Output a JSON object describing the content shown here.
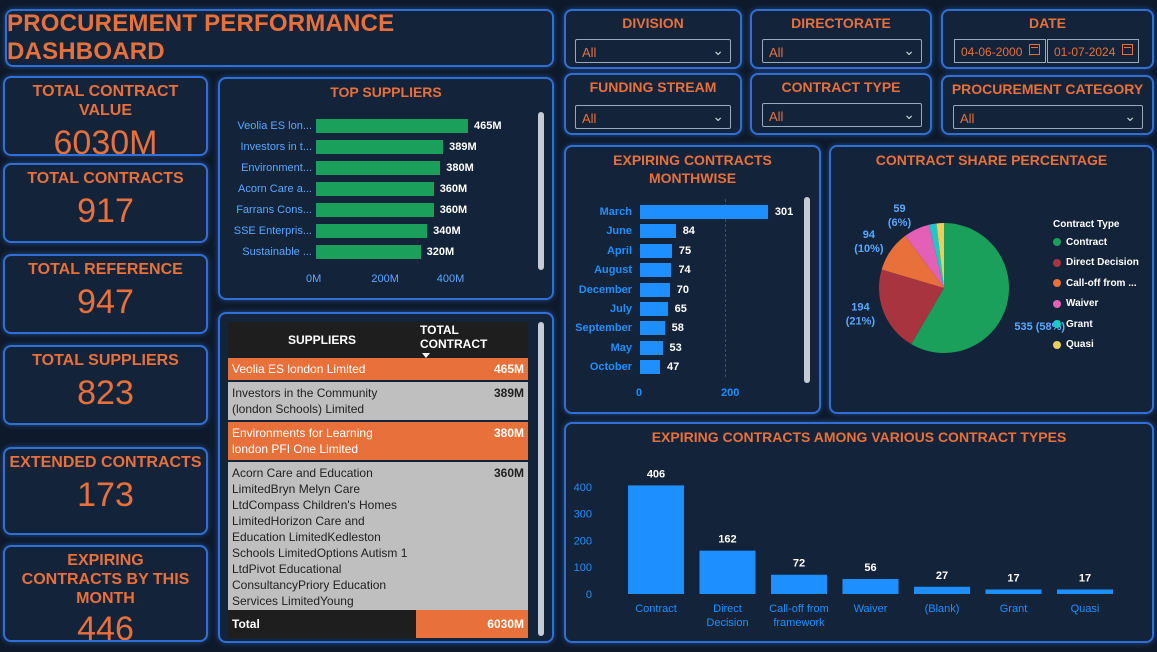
{
  "header": {
    "title": "PROCUREMENT PERFORMANCE DASHBOARD"
  },
  "kpis": [
    {
      "label": "TOTAL CONTRACT VALUE",
      "value": "6030M"
    },
    {
      "label": "TOTAL CONTRACTS",
      "value": "917"
    },
    {
      "label": "TOTAL REFERENCE",
      "value": "947"
    },
    {
      "label": "TOTAL SUPPLIERS",
      "value": "823"
    },
    {
      "label": "EXTENDED CONTRACTS",
      "value": "173"
    },
    {
      "label": "EXPIRING CONTRACTS BY THIS MONTH",
      "value": "446"
    }
  ],
  "slicers": {
    "division": {
      "title": "DIVISION",
      "value": "All"
    },
    "directorate": {
      "title": "DIRECTORATE",
      "value": "All"
    },
    "date": {
      "title": "DATE",
      "from": "04-06-2000",
      "to": "01-07-2024"
    },
    "funding_stream": {
      "title": "FUNDING STREAM",
      "value": "All"
    },
    "contract_type": {
      "title": "CONTRACT TYPE",
      "value": "All"
    },
    "procurement_category": {
      "title": "PROCUREMENT CATEGORY",
      "value": "All"
    }
  },
  "top_suppliers": {
    "title": "TOP SUPPLIERS",
    "color": "#1aa05a",
    "axis_ticks": [
      "0M",
      "200M",
      "400M"
    ],
    "xlim": [
      0,
      520
    ],
    "items": [
      {
        "label": "Veolia ES lon...",
        "value": 465,
        "text": "465M"
      },
      {
        "label": "Investors in t...",
        "value": 389,
        "text": "389M"
      },
      {
        "label": "Environment...",
        "value": 380,
        "text": "380M"
      },
      {
        "label": "Acorn Care a...",
        "value": 360,
        "text": "360M"
      },
      {
        "label": "Farrans Cons...",
        "value": 360,
        "text": "360M"
      },
      {
        "label": "SSE Enterpris...",
        "value": 340,
        "text": "340M"
      },
      {
        "label": "Sustainable ...",
        "value": 320,
        "text": "320M"
      }
    ]
  },
  "suppliers_table": {
    "headers": {
      "supplier": "SUPPLIERS",
      "total": "TOTAL CONTRACT"
    },
    "rows": [
      {
        "supplier": "Veolia ES london Limited",
        "total": "465M"
      },
      {
        "supplier": "Investors in the Community (london Schools) Limited",
        "total": "389M"
      },
      {
        "supplier": "Environments for Learning london PFI One Limited",
        "total": "380M"
      },
      {
        "supplier": "Acorn Care and Education LimitedBryn Melyn Care LtdCompass Children's Homes LimitedHorizon Care and Education LimitedKedleston Schools LimitedOptions Autism 1 LtdPivot Educational ConsultancyPriory Education Services LimitedYoung Foundations LimitedAcorn Care",
        "total": "360M"
      }
    ],
    "total_label": "Total",
    "total_value": "6030M"
  },
  "expiring_monthwise": {
    "title": "EXPIRING CONTRACTS MONTHWISE",
    "color": "#1e8fff",
    "axis_ticks": [
      "0",
      "200"
    ],
    "xlim": [
      0,
      400
    ],
    "items": [
      {
        "label": "March",
        "value": 301
      },
      {
        "label": "June",
        "value": 84
      },
      {
        "label": "April",
        "value": 75
      },
      {
        "label": "August",
        "value": 74
      },
      {
        "label": "December",
        "value": 70
      },
      {
        "label": "July",
        "value": 65
      },
      {
        "label": "September",
        "value": 58
      },
      {
        "label": "May",
        "value": 53
      },
      {
        "label": "October",
        "value": 47
      }
    ]
  },
  "contract_share": {
    "title": "CONTRACT SHARE PERCENTAGE",
    "legend_title": "Contract Type",
    "slices": [
      {
        "name": "Contract",
        "value": 535,
        "pct": 58,
        "color": "#1aa05a",
        "label": "535 (58%)"
      },
      {
        "name": "Direct Decision",
        "value": 194,
        "pct": 21,
        "color": "#a83440",
        "label": "194 (21%)"
      },
      {
        "name": "Call-off from ...",
        "value": 94,
        "pct": 10,
        "color": "#e8703a",
        "label": "94 (10%)"
      },
      {
        "name": "Waiver",
        "value": 59,
        "pct": 6,
        "color": "#e45fb6",
        "label": "59 (6%)"
      },
      {
        "name": "Grant",
        "value": 17,
        "pct": 2,
        "color": "#1fc8c8",
        "label": ""
      },
      {
        "name": "Quasi",
        "value": 17,
        "pct": 2,
        "color": "#e9cf5a",
        "label": ""
      }
    ]
  },
  "chart_data": {
    "type": "bar",
    "title": "EXPIRING CONTRACTS AMONG VARIOUS CONTRACT TYPES",
    "categories": [
      "Contract",
      "Direct Decision",
      "Call-off from framework",
      "Waiver",
      "(Blank)",
      "Grant",
      "Quasi"
    ],
    "values": [
      406,
      162,
      72,
      56,
      27,
      17,
      17
    ],
    "y_ticks": [
      0,
      100,
      200,
      300,
      400
    ],
    "ylim": [
      0,
      440
    ],
    "color": "#1e8fff"
  }
}
